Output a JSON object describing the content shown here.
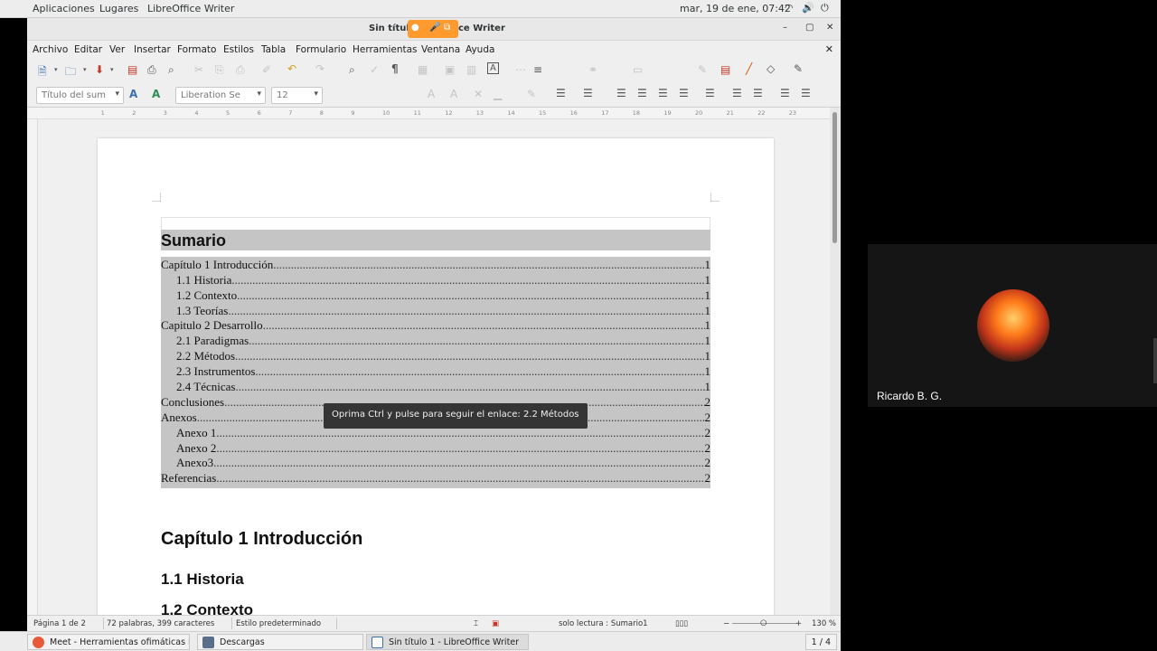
{
  "topbar": {
    "menus": [
      "Aplicaciones",
      "Lugares",
      "LibreOffice Writer"
    ],
    "clock": "mar, 19 de ene, 07:42"
  },
  "window": {
    "title": "Sin título 1 - LibreOffice Writer",
    "title_visible": "Sin título",
    "title_suffix": "ce Writer"
  },
  "menubar": [
    "Archivo",
    "Editar",
    "Ver",
    "Insertar",
    "Formato",
    "Estilos",
    "Tabla",
    "Formulario",
    "Herramientas",
    "Ventana",
    "Ayuda"
  ],
  "formatting": {
    "paragraph_style": "Título del sum",
    "font_name": "Liberation Se",
    "font_size": "12"
  },
  "document": {
    "toc_title": "Sumario",
    "toc_entries": [
      {
        "text": "Capítulo 1 Introducción",
        "page": "1",
        "level": 1
      },
      {
        "text": "1.1 Historia",
        "page": "1",
        "level": 2
      },
      {
        "text": "1.2 Contexto",
        "page": "1",
        "level": 2
      },
      {
        "text": "1.3 Teorías",
        "page": "1",
        "level": 2
      },
      {
        "text": "Capitulo 2 Desarrollo",
        "page": "1",
        "level": 1
      },
      {
        "text": "2.1 Paradigmas",
        "page": "1",
        "level": 2
      },
      {
        "text": "2.2 Métodos",
        "page": "1",
        "level": 2
      },
      {
        "text": "2.3 Instrumentos",
        "page": "1",
        "level": 2
      },
      {
        "text": "2.4 Técnicas",
        "page": "1",
        "level": 2
      },
      {
        "text": "Conclusiones",
        "page": "2",
        "level": 1
      },
      {
        "text": "Anexos",
        "page": "2",
        "level": 1
      },
      {
        "text": "Anexo 1",
        "page": "2",
        "level": 2
      },
      {
        "text": "Anexo 2",
        "page": "2",
        "level": 2
      },
      {
        "text": "Anexo3",
        "page": "2",
        "level": 2
      },
      {
        "text": "Referencias",
        "page": "2",
        "level": 1
      }
    ],
    "heading1": "Capítulo 1 Introducción",
    "heading2": "1.1 Historia",
    "heading3_partial": "1.2 Contexto"
  },
  "tooltip": "Oprima Ctrl y pulse para seguir el enlace: 2.2 Métodos",
  "statusbar": {
    "page": "Página 1 de 2",
    "words": "72 palabras, 399 caracteres",
    "page_style": "Estilo predeterminado",
    "mode": "solo lectura : Sumario1",
    "zoom": "130 %"
  },
  "taskbar": {
    "tasks": [
      "Meet - Herramientas ofimáticas IIG...",
      "Descargas",
      "Sin título 1 - LibreOffice Writer"
    ],
    "pager": "1 / 4"
  },
  "meet": {
    "participant": "Ricardo B. G."
  },
  "colors": {
    "toc_shading": "#c5c5c5",
    "tooltip_bg": "#353535",
    "meet_bg": "#151515"
  }
}
